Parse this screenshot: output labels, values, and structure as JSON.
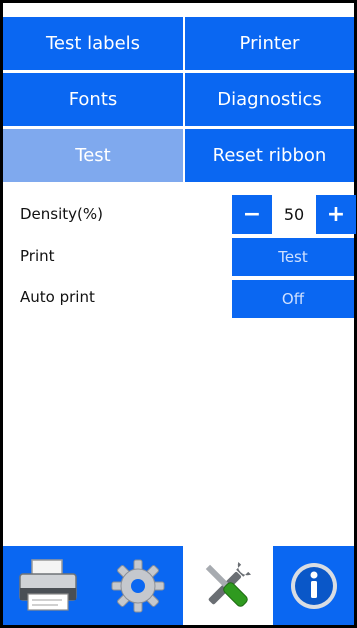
{
  "tabs": {
    "test_labels": "Test labels",
    "printer": "Printer",
    "fonts": "Fonts",
    "diagnostics": "Diagnostics",
    "test": "Test",
    "reset_ribbon": "Reset ribbon",
    "selected": "Test"
  },
  "settings": {
    "density": {
      "label": "Density(%)",
      "minus": "−",
      "value": "50",
      "plus": "+"
    },
    "print": {
      "label": "Print",
      "button": "Test"
    },
    "auto_print": {
      "label": "Auto print",
      "value": "Off"
    }
  },
  "toolbar": {
    "items": [
      {
        "icon": "printer-icon",
        "selected": false
      },
      {
        "icon": "gear-icon",
        "selected": false
      },
      {
        "icon": "tools-icon",
        "selected": true
      },
      {
        "icon": "info-icon",
        "selected": false
      }
    ]
  },
  "colors": {
    "primary": "#0a67f2",
    "selected_tab": "#7fa9ee",
    "frame": "#000000"
  }
}
